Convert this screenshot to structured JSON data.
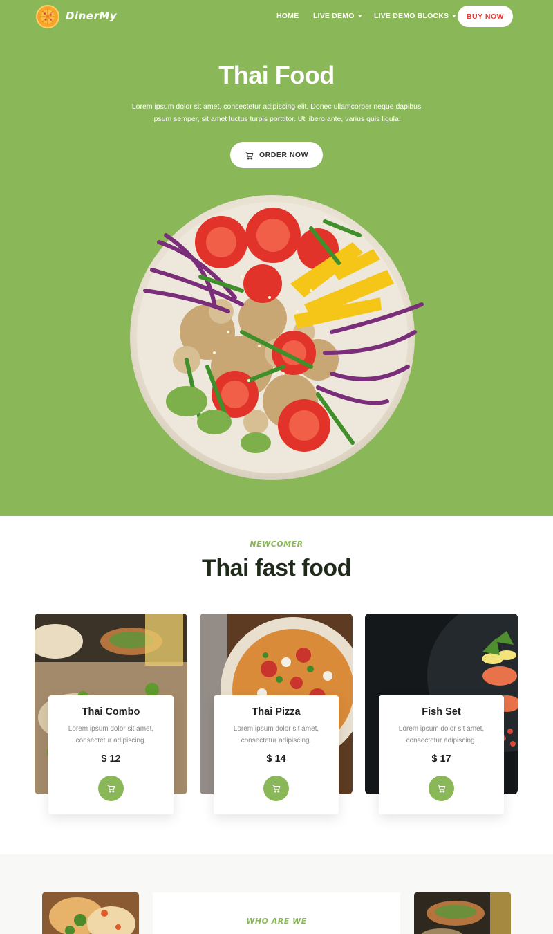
{
  "brand": {
    "name": "DinerMy",
    "logo_icon": "pizza-icon"
  },
  "nav": {
    "items": [
      {
        "label": "HOME",
        "dropdown": false
      },
      {
        "label": "LIVE DEMO",
        "dropdown": true
      },
      {
        "label": "LIVE DEMO BLOCKS",
        "dropdown": true
      }
    ],
    "buy_label": "BUY NOW"
  },
  "hero": {
    "title": "Thai Food",
    "description": "Lorem ipsum dolor sit amet, consectetur adipiscing elit. Donec ullamcorper neque dapibus ipsum semper, sit amet luctus turpis porttitor. Ut libero ante, varius quis ligula.",
    "order_label": "ORDER NOW",
    "order_icon": "cart-icon"
  },
  "fast_food": {
    "eyebrow": "NEWCOMER",
    "title": "Thai fast food",
    "cards": [
      {
        "title": "Thai Combo",
        "description": "Lorem ipsum dolor sit amet, consectetur adipiscing.",
        "price": "$ 12",
        "icon": "cart-icon"
      },
      {
        "title": "Thai Pizza",
        "description": "Lorem ipsum dolor sit amet, consectetur adipiscing.",
        "price": "$ 14",
        "icon": "cart-icon"
      },
      {
        "title": "Fish Set",
        "description": "Lorem ipsum dolor sit amet, consectetur adipiscing.",
        "price": "$ 17",
        "icon": "cart-icon"
      }
    ]
  },
  "about": {
    "eyebrow": "WHO ARE WE"
  },
  "colors": {
    "accent": "#8ab758",
    "buy_text": "#e63b3b",
    "heading": "#1f2a1b"
  }
}
